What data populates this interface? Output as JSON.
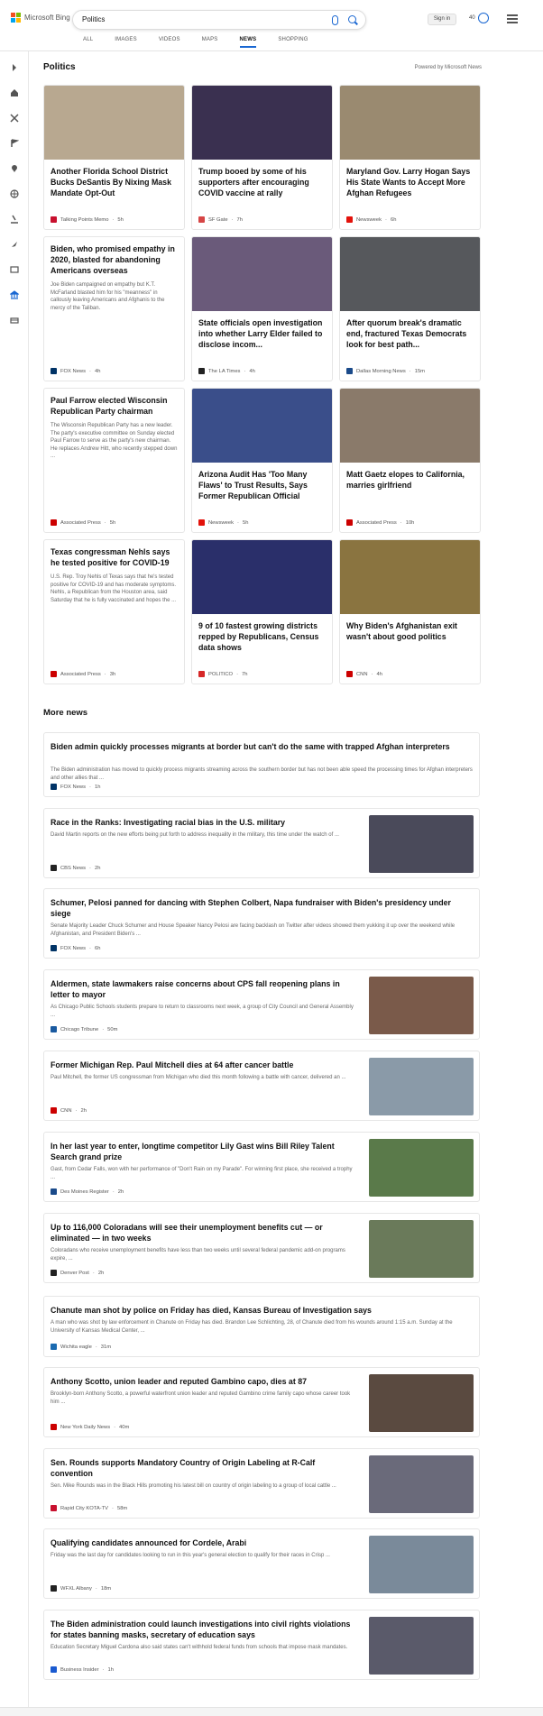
{
  "header": {
    "brand": "Microsoft Bing",
    "query": "Politics",
    "signin": "Sign in",
    "reward_points": "40",
    "tabs": [
      {
        "label": "ALL"
      },
      {
        "label": "IMAGES"
      },
      {
        "label": "VIDEOS"
      },
      {
        "label": "MAPS"
      },
      {
        "label": "NEWS"
      },
      {
        "label": "SHOPPING"
      }
    ],
    "active_tab": "NEWS",
    "accent": "#1967d2"
  },
  "section": {
    "title": "Politics",
    "powered_by": "Powered by Microsoft News"
  },
  "cards": [
    {
      "title": "Another Florida School District Bucks DeSantis By Nixing Mask Mandate Opt-Out",
      "source": "Talking Points Memo",
      "time": "5h",
      "source_color": "#c8102e",
      "has_image": true,
      "img_color": "#b8a890"
    },
    {
      "title": "Trump booed by some of his supporters after encouraging COVID vaccine at rally",
      "source": "SF Gate",
      "time": "7h",
      "source_color": "#d64545",
      "has_image": true,
      "img_color": "#3a3050"
    },
    {
      "title": "Maryland Gov. Larry Hogan Says His State Wants to Accept More Afghan Refugees",
      "source": "Newsweek",
      "time": "6h",
      "source_color": "#e3120b",
      "has_image": true,
      "img_color": "#9a8a70"
    },
    {
      "title": "Biden, who promised empathy in 2020, blasted for abandoning Americans overseas",
      "snippet": "Joe Biden campaigned on empathy but K.T. McFarland blasted him for his \"meanness\" in callously leaving Americans and Afghanis to the mercy of the Taliban.",
      "source": "FOX News",
      "time": "4h",
      "source_color": "#003366",
      "has_image": false
    },
    {
      "title": "State officials open investigation into whether Larry Elder failed to disclose incom...",
      "source": "The LA Times",
      "time": "4h",
      "source_color": "#222222",
      "has_image": true,
      "img_color": "#6a5a7a"
    },
    {
      "title": "After quorum break's dramatic end, fractured Texas Democrats look for best path...",
      "source": "Dallas Morning News",
      "time": "15m",
      "source_color": "#1a4a8a",
      "has_image": true,
      "img_color": "#56585c"
    },
    {
      "title": "Paul Farrow elected Wisconsin Republican Party chairman",
      "snippet": "The Wisconsin Republican Party has a new leader. The party's executive committee on Sunday elected Paul Farrow to serve as the party's new chairman. He replaces Andrew Hitt, who recently stepped down ...",
      "source": "Associated Press",
      "time": "5h",
      "source_color": "#cc0000",
      "has_image": false
    },
    {
      "title": "Arizona Audit Has 'Too Many Flaws' to Trust Results, Says Former Republican Official",
      "source": "Newsweek",
      "time": "5h",
      "source_color": "#e3120b",
      "has_image": true,
      "img_color": "#3a4e8a"
    },
    {
      "title": "Matt Gaetz elopes to California, marries girlfriend",
      "source": "Associated Press",
      "time": "10h",
      "source_color": "#cc0000",
      "has_image": true,
      "img_color": "#8a7a6a"
    },
    {
      "title": "Texas congressman Nehls says he tested positive for COVID-19",
      "snippet": "U.S. Rep. Troy Nehls of Texas says that he's tested positive for COVID-19 and has moderate symptoms. Nehls, a Republican from the Houston area, said Saturday that he is fully vaccinated and hopes the ...",
      "source": "Associated Press",
      "time": "3h",
      "source_color": "#cc0000",
      "has_image": false
    },
    {
      "title": "9 of 10 fastest growing districts repped by Republicans, Census data shows",
      "source": "POLITICO",
      "time": "7h",
      "source_color": "#d62828",
      "has_image": true,
      "img_color": "#2a2f6a"
    },
    {
      "title": "Why Biden's Afghanistan exit wasn't about good politics",
      "source": "CNN",
      "time": "4h",
      "source_color": "#cc0000",
      "has_image": true,
      "img_color": "#8a7440"
    }
  ],
  "more_news_title": "More news",
  "more_news": [
    {
      "title": "Biden admin quickly processes migrants at border but can't do the same with trapped Afghan interpreters",
      "snippet": "The Biden administration has moved to quickly process migrants streaming across the southern border but has not been able speed the processing times for Afghan interpreters and other allies that ...",
      "source": "FOX News",
      "time": "1h",
      "source_color": "#003366",
      "has_image": false
    },
    {
      "title": "Race in the Ranks: Investigating racial bias in the U.S. military",
      "snippet": "David Martin reports on the new efforts being put forth to address inequality in the military, this time under the watch of ...",
      "source": "CBS News",
      "time": "2h",
      "source_color": "#222222",
      "has_image": true,
      "img_color": "#4a4a5a"
    },
    {
      "title": "Schumer, Pelosi panned for dancing with Stephen Colbert, Napa fundraiser with Biden's presidency under siege",
      "snippet": "Senate Majority Leader Chuck Schumer and House Speaker Nancy Pelosi are facing backlash on Twitter after videos showed them yukking it up over the weekend while Afghanistan, and President Biden's ...",
      "source": "FOX News",
      "time": "6h",
      "source_color": "#003366",
      "has_image": false
    },
    {
      "title": "Aldermen, state lawmakers raise concerns about CPS fall reopening plans in letter to mayor",
      "snippet": "As Chicago Public Schools students prepare to return to classrooms next week, a group of City Council and General Assembly ...",
      "source": "Chicago Tribune",
      "time": "50m",
      "source_color": "#1a5aa0",
      "has_image": true,
      "img_color": "#7a5a4a"
    },
    {
      "title": "Former Michigan Rep. Paul Mitchell dies at 64 after cancer battle",
      "snippet": "Paul Mitchell, the former US congressman from Michigan who died this month following a battle with cancer, delivered an ...",
      "source": "CNN",
      "time": "2h",
      "source_color": "#cc0000",
      "has_image": true,
      "img_color": "#8a9aa8"
    },
    {
      "title": "In her last year to enter, longtime competitor Lily Gast wins Bill Riley Talent Search grand prize",
      "snippet": "Gast, from Cedar Falls, won with her performance of \"Don't Rain on my Parade\". For winning first place, she received a trophy ...",
      "source": "Des Moines Register",
      "time": "2h",
      "source_color": "#1a4a8a",
      "has_image": true,
      "img_color": "#5a7a4a"
    },
    {
      "title": "Up to 116,000 Coloradans will see their unemployment benefits cut — or eliminated — in two weeks",
      "snippet": "Coloradans who receive unemployment benefits have less than two weeks until several federal pandemic add-on programs expire, ...",
      "source": "Denver Post",
      "time": "2h",
      "source_color": "#222222",
      "has_image": true,
      "img_color": "#6a7a5a"
    },
    {
      "title": "Chanute man shot by police on Friday has died, Kansas Bureau of Investigation says",
      "snippet": "A man who was shot by law enforcement in Chanute on Friday has died. Brandon Lee Schlichting, 28, of Chanute died from his wounds around 1:15 a.m. Sunday at the University of Kansas Medical Center, ...",
      "source": "Wichita eagle",
      "time": "31m",
      "source_color": "#1a6ab0",
      "has_image": false
    },
    {
      "title": "Anthony Scotto, union leader and reputed Gambino capo, dies at 87",
      "snippet": "Brooklyn-born Anthony Scotto, a powerful waterfront union leader and reputed Gambino crime family capo whose career took him ...",
      "source": "New York Daily News",
      "time": "40m",
      "source_color": "#cc0000",
      "has_image": true,
      "img_color": "#5a4a40"
    },
    {
      "title": "Sen. Rounds supports Mandatory Country of Origin Labeling at R-Calf convention",
      "snippet": "Sen. Mike Rounds was in the Black Hills promoting his latest bill on country of origin labeling to a group of local cattle ...",
      "source": "Rapid City KOTA-TV",
      "time": "58m",
      "source_color": "#c8102e",
      "has_image": true,
      "img_color": "#6a6a7a"
    },
    {
      "title": "Qualifying candidates announced for Cordele, Arabi",
      "snippet": "Friday was the last day for candidates looking to run in this year's general election to qualify for their races in Crisp ...",
      "source": "WFXL Albany",
      "time": "18m",
      "source_color": "#222222",
      "has_image": true,
      "img_color": "#7a8a9a"
    },
    {
      "title": "The Biden administration could launch investigations into civil rights violations for states banning masks, secretary of education says",
      "snippet": "Education Secretary Miguel Cardona also said states can't withhold federal funds from schools that impose mask mandates.",
      "source": "Business Insider",
      "time": "1h",
      "source_color": "#1a5ad0",
      "has_image": true,
      "img_color": "#5a5a6a"
    }
  ]
}
